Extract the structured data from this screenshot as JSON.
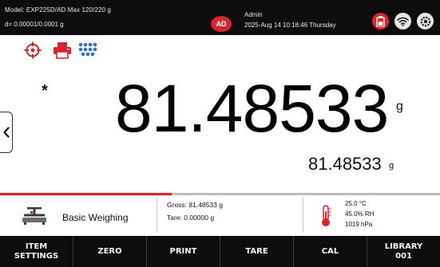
{
  "header": {
    "model_line": "Model: EXP225D/AD   Max 120/220 g",
    "division_line": "d= 0.00001/0.0001 g",
    "avatar_initials": "AD",
    "user_name": "Admin",
    "datetime": "2025-Aug 14 10:18:46 Thursday",
    "icons": [
      "battery-icon",
      "wifi-icon",
      "settings-icon"
    ]
  },
  "toolbar": {
    "icons": [
      "target-icon",
      "printer-icon",
      "dots-grid-icon"
    ]
  },
  "weighing": {
    "stable_marker": "*",
    "main_value": "81.48533",
    "main_unit": "g",
    "secondary_value": "81.48533",
    "secondary_unit": "g",
    "capacity_fraction": 0.39
  },
  "info": {
    "mode_label": "Basic Weighing",
    "gross": "Gross: 81.48533 g",
    "tare": "Tare: 0.00000 g",
    "temperature": "25.0 °C",
    "humidity": "45.0% RH",
    "pressure": "1019 hPa"
  },
  "softkeys": [
    {
      "line1": "ITEM",
      "line2": "SETTINGS"
    },
    {
      "line1": "ZERO",
      "line2": ""
    },
    {
      "line1": "PRINT",
      "line2": ""
    },
    {
      "line1": "TARE",
      "line2": ""
    },
    {
      "line1": "CAL",
      "line2": ""
    },
    {
      "line1": "LIBRARY",
      "line2": "001"
    }
  ],
  "colors": {
    "accent_red": "#d8262a",
    "bar_black": "#0d0d0d",
    "icon_blue": "#2e6fd1"
  }
}
